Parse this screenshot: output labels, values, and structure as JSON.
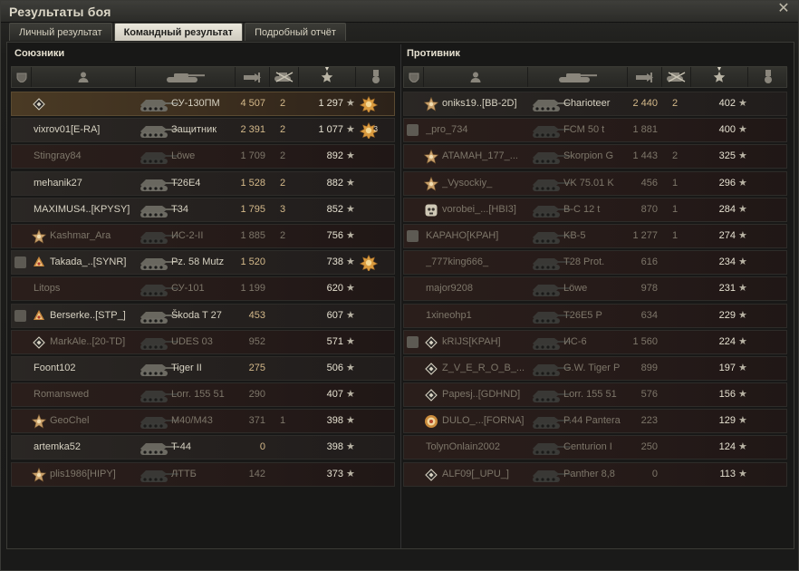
{
  "window": {
    "title": "Результаты боя"
  },
  "tabs": [
    {
      "label": "Личный результат",
      "active": false
    },
    {
      "label": "Командный результат",
      "active": true
    },
    {
      "label": "Подробный отчёт",
      "active": false
    }
  ],
  "allies": {
    "title": "Союзники",
    "rows": [
      {
        "player": "",
        "vehicle": "СУ-130ПМ",
        "damage": "4 507",
        "kills": "2",
        "xp": "1 297",
        "state": "me",
        "platoon": false,
        "badge": "diamond",
        "medal": "gold-medal",
        "medal_count": ""
      },
      {
        "player": "vixrov01[E-RA]",
        "vehicle": "Защитник",
        "damage": "2 391",
        "kills": "2",
        "xp": "1 077",
        "state": "alive",
        "platoon": false,
        "badge": "",
        "medal": "gold-medal",
        "medal_count": "3"
      },
      {
        "player": "Stingray84",
        "vehicle": "Löwe",
        "damage": "1 709",
        "kills": "2",
        "xp": "892",
        "state": "dead",
        "platoon": false,
        "badge": "",
        "medal": "",
        "medal_count": ""
      },
      {
        "player": "mehanik27",
        "vehicle": "T26E4",
        "damage": "1 528",
        "kills": "2",
        "xp": "882",
        "state": "alive",
        "platoon": false,
        "badge": "",
        "medal": "",
        "medal_count": ""
      },
      {
        "player": "MAXIMUS4..[KPYSY]",
        "vehicle": "T34",
        "damage": "1 795",
        "kills": "3",
        "xp": "852",
        "state": "alive",
        "platoon": false,
        "badge": "",
        "medal": "",
        "medal_count": ""
      },
      {
        "player": "Kashmar_Ara",
        "vehicle": "ИС-2-II",
        "damage": "1 885",
        "kills": "2",
        "xp": "756",
        "state": "dead",
        "platoon": false,
        "badge": "star",
        "medal": "",
        "medal_count": ""
      },
      {
        "player": "Takada_..[SYNR]",
        "vehicle": "Pz. 58 Mutz",
        "damage": "1 520",
        "kills": "",
        "xp": "738",
        "state": "alive",
        "platoon": true,
        "badge": "multi",
        "medal": "gold-medal",
        "medal_count": ""
      },
      {
        "player": "Litops",
        "vehicle": "СУ-101",
        "damage": "1 199",
        "kills": "",
        "xp": "620",
        "state": "dead",
        "platoon": false,
        "badge": "",
        "medal": "",
        "medal_count": ""
      },
      {
        "player": "Berserke..[STP_]",
        "vehicle": "Škoda T 27",
        "damage": "453",
        "kills": "",
        "xp": "607",
        "state": "alive",
        "platoon": true,
        "badge": "multi",
        "medal": "",
        "medal_count": ""
      },
      {
        "player": "MarkAle..[20-TD]",
        "vehicle": "UDES 03",
        "damage": "952",
        "kills": "",
        "xp": "571",
        "state": "dead",
        "platoon": false,
        "badge": "diamond",
        "medal": "",
        "medal_count": ""
      },
      {
        "player": "Foont102",
        "vehicle": "Tiger II",
        "damage": "275",
        "kills": "",
        "xp": "506",
        "state": "alive",
        "platoon": false,
        "badge": "",
        "medal": "",
        "medal_count": ""
      },
      {
        "player": "Romanswed",
        "vehicle": "Lorr. 155 51",
        "damage": "290",
        "kills": "",
        "xp": "407",
        "state": "dead",
        "platoon": false,
        "badge": "",
        "medal": "",
        "medal_count": ""
      },
      {
        "player": "GeoChel",
        "vehicle": "M40/M43",
        "damage": "371",
        "kills": "1",
        "xp": "398",
        "state": "dead",
        "platoon": false,
        "badge": "star",
        "medal": "",
        "medal_count": ""
      },
      {
        "player": "artemka52",
        "vehicle": "T-44",
        "damage": "0",
        "kills": "",
        "xp": "398",
        "state": "alive",
        "platoon": false,
        "badge": "",
        "medal": "",
        "medal_count": ""
      },
      {
        "player": "plis1986[HIPY]",
        "vehicle": "ЛТТБ",
        "damage": "142",
        "kills": "",
        "xp": "373",
        "state": "dead",
        "platoon": false,
        "badge": "star",
        "medal": "",
        "medal_count": ""
      }
    ]
  },
  "enemies": {
    "title": "Противник",
    "rows": [
      {
        "player": "oniks19..[BB-2D]",
        "vehicle": "Charioteer",
        "damage": "2 440",
        "kills": "2",
        "xp": "402",
        "state": "alive",
        "platoon": false,
        "badge": "star",
        "medal": "",
        "medal_count": ""
      },
      {
        "player": "_pro_734",
        "vehicle": "FCM 50 t",
        "damage": "1 881",
        "kills": "",
        "xp": "400",
        "state": "dead",
        "platoon": true,
        "badge": "",
        "medal": "",
        "medal_count": ""
      },
      {
        "player": "ATAMAH_177_...",
        "vehicle": "Skorpion G",
        "damage": "1 443",
        "kills": "2",
        "xp": "325",
        "state": "dead",
        "platoon": false,
        "badge": "star",
        "medal": "",
        "medal_count": ""
      },
      {
        "player": "_Vysockiy_",
        "vehicle": "VK 75.01 K",
        "damage": "456",
        "kills": "1",
        "xp": "296",
        "state": "dead",
        "platoon": false,
        "badge": "star",
        "medal": "",
        "medal_count": ""
      },
      {
        "player": "vorobei_...[HBI3]",
        "vehicle": "B-C 12 t",
        "damage": "870",
        "kills": "1",
        "xp": "284",
        "state": "dead",
        "platoon": false,
        "badge": "skull",
        "medal": "",
        "medal_count": ""
      },
      {
        "player": "KAPAHO[KPAH]",
        "vehicle": "KB-5",
        "damage": "1 277",
        "kills": "1",
        "xp": "274",
        "state": "dead",
        "platoon": true,
        "badge": "",
        "medal": "",
        "medal_count": ""
      },
      {
        "player": "_777king666_",
        "vehicle": "T28 Prot.",
        "damage": "616",
        "kills": "",
        "xp": "234",
        "state": "dead",
        "platoon": false,
        "badge": "",
        "medal": "",
        "medal_count": ""
      },
      {
        "player": "major9208",
        "vehicle": "Löwe",
        "damage": "978",
        "kills": "",
        "xp": "231",
        "state": "dead",
        "platoon": false,
        "badge": "",
        "medal": "",
        "medal_count": ""
      },
      {
        "player": "1xineohp1",
        "vehicle": "T26E5 P",
        "damage": "634",
        "kills": "",
        "xp": "229",
        "state": "dead",
        "platoon": false,
        "badge": "",
        "medal": "",
        "medal_count": ""
      },
      {
        "player": "kRIJS[KPAH]",
        "vehicle": "ИС-6",
        "damage": "1 560",
        "kills": "",
        "xp": "224",
        "state": "dead",
        "platoon": true,
        "badge": "diamond",
        "medal": "",
        "medal_count": ""
      },
      {
        "player": "Z_V_E_R_O_B_...",
        "vehicle": "G.W. Tiger P",
        "damage": "899",
        "kills": "",
        "xp": "197",
        "state": "dead",
        "platoon": false,
        "badge": "diamond",
        "medal": "",
        "medal_count": ""
      },
      {
        "player": "Papesj..[GDHND]",
        "vehicle": "Lorr. 155 51",
        "damage": "576",
        "kills": "",
        "xp": "156",
        "state": "dead",
        "platoon": false,
        "badge": "diamond",
        "medal": "",
        "medal_count": ""
      },
      {
        "player": "DULO_...[FORNA]",
        "vehicle": "P.44 Pantera",
        "damage": "223",
        "kills": "",
        "xp": "129",
        "state": "dead",
        "platoon": false,
        "badge": "target",
        "medal": "",
        "medal_count": ""
      },
      {
        "player": "TolynOnlain2002",
        "vehicle": "Centurion I",
        "damage": "250",
        "kills": "",
        "xp": "124",
        "state": "dead",
        "platoon": false,
        "badge": "",
        "medal": "",
        "medal_count": ""
      },
      {
        "player": "ALF09[_UPU_]",
        "vehicle": "Panther 8,8",
        "damage": "0",
        "kills": "",
        "xp": "113",
        "state": "dead",
        "platoon": false,
        "badge": "diamond",
        "medal": "",
        "medal_count": ""
      }
    ]
  },
  "icons": {
    "close": "close-icon",
    "platoon": "platoon-icon",
    "player": "player-icon",
    "vehicle": "tank-icon",
    "damage": "damage-icon",
    "kills": "kills-icon",
    "xp": "xp-star-icon",
    "medals": "medal-icon"
  },
  "colors": {
    "accent": "#d4b98a",
    "me_row": "#4a3a24",
    "dead_row": "#2a1e1b",
    "text": "#d7d2c2"
  }
}
